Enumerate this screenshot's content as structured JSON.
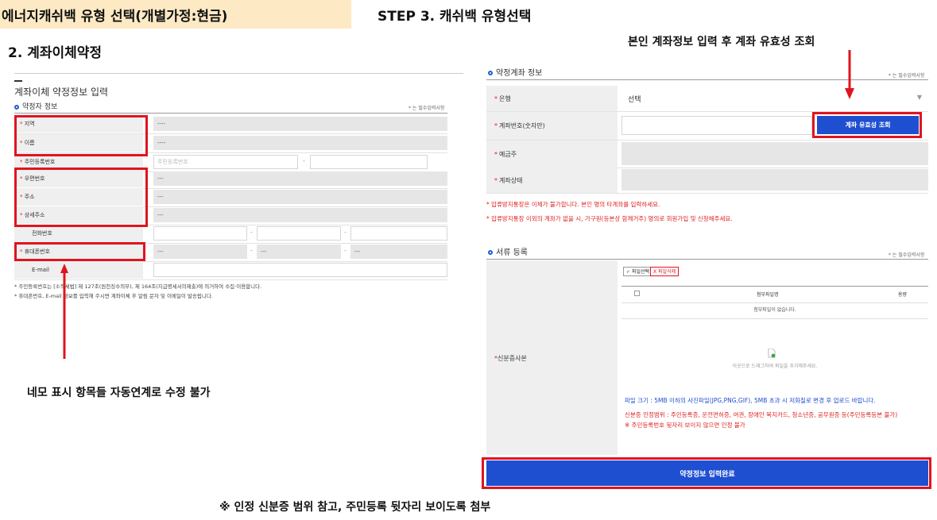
{
  "header": {
    "left_title": "에너지캐쉬백 유형 선택(개별가정:현금)",
    "step_title": "STEP 3. 캐쉬백 유형선택",
    "section_title": "2. 계좌이체약정"
  },
  "annotations": {
    "top_right": "본인 계좌정보 입력 후 계좌 유효성 조회",
    "left_bottom": "네모 표시 항목들 자동연계로 수정 불가",
    "bottom": "※ 인정 신분증 범위 참고, 주민등록 뒷자리 보이도록 첨부"
  },
  "left_form": {
    "title": "계좌이체 약정정보 입력",
    "subtitle": "약정자 정보",
    "required_note": "* 는 필수입력사항",
    "rows": [
      {
        "label": "지역",
        "required": true,
        "value": "----"
      },
      {
        "label": "이름",
        "required": true,
        "value": "----"
      },
      {
        "label": "주민등록번호",
        "required": true,
        "placeholder": "주민등록번호"
      },
      {
        "label": "우편번호",
        "required": true,
        "value": "---"
      },
      {
        "label": "주소",
        "required": true,
        "value": "---"
      },
      {
        "label": "상세주소",
        "required": true,
        "value": "---"
      },
      {
        "label": "전화번호",
        "required": false
      },
      {
        "label": "휴대폰번호",
        "required": true,
        "values": [
          "---",
          "---",
          "---"
        ]
      },
      {
        "label": "E-mail",
        "required": false
      }
    ],
    "notes": [
      "* 주민등록번호는 [소득세법] 제 127조(원천징수의무), 제 164조(지급명세서의제출)에 의거하여 수집·이용합니다.",
      "* 휴대폰번호, E-mail 정보를 입력해 주시면 계좌이체 후 알림 문자 및 이메일이 발송됩니다."
    ]
  },
  "account_section": {
    "title": "약정계좌 정보",
    "required_note": "* 는 필수입력사항",
    "bank_label": "은행",
    "bank_selected": "선택",
    "account_label": "계좌번호(숫자만)",
    "verify_button": "계좌 유효성 조회",
    "holder_label": "예금주",
    "status_label": "계좌상태",
    "notes": [
      "* 압류방지통장은 이체가 불가합니다. 본인 명의 타계좌를 입력하세요.",
      "* 압류방지통장 이외의 계좌가 없을 시, 가구원(등본상 함께거주) 명의로 회원가입 및 신청해주세요."
    ]
  },
  "doc_section": {
    "title": "서류 등록",
    "required_note": "* 는 필수입력사항",
    "id_label": "신분증사본",
    "select_file_btn": "파일선택",
    "delete_file_btn": "파일삭제",
    "col_name": "첨부파일명",
    "col_size": "용량",
    "empty_text": "첨부파일이 없습니다.",
    "drop_text": "이곳으로 드래그하여 파일을 추가해주세요.",
    "size_note": "파일 크기 : 5MB 이하의 사진파일(JPG,PNG,GIF), 5MB 초과 시 저화질로 변경 후 업로드 바랍니다.",
    "id_range_note": "신분증 인정범위 : 주민등록증, 운전면허증, 여권, 장애인 복지카드, 청소년증, 공무원증 등(주민등록등본 불가)",
    "id_back_note": "※ 주민등록번호 뒷자리 보이지 않으면 인정 불가"
  },
  "submit_button": "약정정보 입력완료",
  "colors": {
    "red_highlight": "#e0141e",
    "primary_blue": "#1f4fd1",
    "header_bg": "#fde9c4"
  }
}
